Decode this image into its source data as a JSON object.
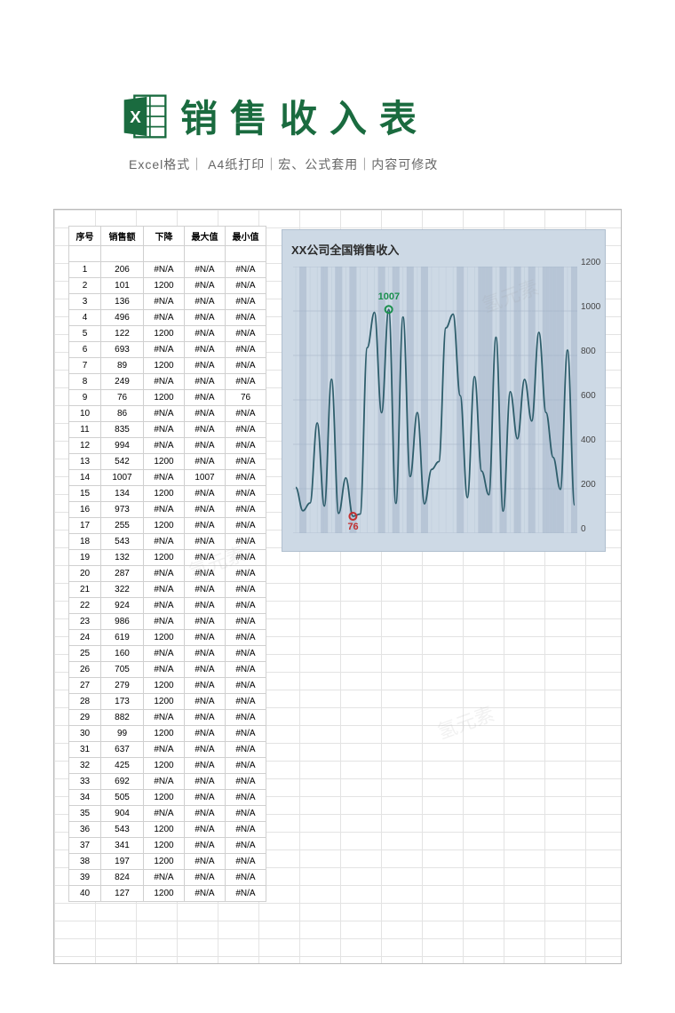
{
  "header": {
    "title": "销售收入表",
    "subtitle": "Excel格式｜ A4纸打印｜宏、公式套用｜内容可修改"
  },
  "table": {
    "columns": [
      "序号",
      "销售额",
      "下降",
      "最大值",
      "最小值"
    ],
    "rows": [
      {
        "i": 1,
        "s": 206,
        "d": "#N/A",
        "mx": "#N/A",
        "mn": "#N/A"
      },
      {
        "i": 2,
        "s": 101,
        "d": 1200,
        "mx": "#N/A",
        "mn": "#N/A"
      },
      {
        "i": 3,
        "s": 136,
        "d": "#N/A",
        "mx": "#N/A",
        "mn": "#N/A"
      },
      {
        "i": 4,
        "s": 496,
        "d": "#N/A",
        "mx": "#N/A",
        "mn": "#N/A"
      },
      {
        "i": 5,
        "s": 122,
        "d": 1200,
        "mx": "#N/A",
        "mn": "#N/A"
      },
      {
        "i": 6,
        "s": 693,
        "d": "#N/A",
        "mx": "#N/A",
        "mn": "#N/A"
      },
      {
        "i": 7,
        "s": 89,
        "d": 1200,
        "mx": "#N/A",
        "mn": "#N/A"
      },
      {
        "i": 8,
        "s": 249,
        "d": "#N/A",
        "mx": "#N/A",
        "mn": "#N/A"
      },
      {
        "i": 9,
        "s": 76,
        "d": 1200,
        "mx": "#N/A",
        "mn": 76
      },
      {
        "i": 10,
        "s": 86,
        "d": "#N/A",
        "mx": "#N/A",
        "mn": "#N/A"
      },
      {
        "i": 11,
        "s": 835,
        "d": "#N/A",
        "mx": "#N/A",
        "mn": "#N/A"
      },
      {
        "i": 12,
        "s": 994,
        "d": "#N/A",
        "mx": "#N/A",
        "mn": "#N/A"
      },
      {
        "i": 13,
        "s": 542,
        "d": 1200,
        "mx": "#N/A",
        "mn": "#N/A"
      },
      {
        "i": 14,
        "s": 1007,
        "d": "#N/A",
        "mx": 1007,
        "mn": "#N/A"
      },
      {
        "i": 15,
        "s": 134,
        "d": 1200,
        "mx": "#N/A",
        "mn": "#N/A"
      },
      {
        "i": 16,
        "s": 973,
        "d": "#N/A",
        "mx": "#N/A",
        "mn": "#N/A"
      },
      {
        "i": 17,
        "s": 255,
        "d": 1200,
        "mx": "#N/A",
        "mn": "#N/A"
      },
      {
        "i": 18,
        "s": 543,
        "d": "#N/A",
        "mx": "#N/A",
        "mn": "#N/A"
      },
      {
        "i": 19,
        "s": 132,
        "d": 1200,
        "mx": "#N/A",
        "mn": "#N/A"
      },
      {
        "i": 20,
        "s": 287,
        "d": "#N/A",
        "mx": "#N/A",
        "mn": "#N/A"
      },
      {
        "i": 21,
        "s": 322,
        "d": "#N/A",
        "mx": "#N/A",
        "mn": "#N/A"
      },
      {
        "i": 22,
        "s": 924,
        "d": "#N/A",
        "mx": "#N/A",
        "mn": "#N/A"
      },
      {
        "i": 23,
        "s": 986,
        "d": "#N/A",
        "mx": "#N/A",
        "mn": "#N/A"
      },
      {
        "i": 24,
        "s": 619,
        "d": 1200,
        "mx": "#N/A",
        "mn": "#N/A"
      },
      {
        "i": 25,
        "s": 160,
        "d": "#N/A",
        "mx": "#N/A",
        "mn": "#N/A"
      },
      {
        "i": 26,
        "s": 705,
        "d": "#N/A",
        "mx": "#N/A",
        "mn": "#N/A"
      },
      {
        "i": 27,
        "s": 279,
        "d": 1200,
        "mx": "#N/A",
        "mn": "#N/A"
      },
      {
        "i": 28,
        "s": 173,
        "d": 1200,
        "mx": "#N/A",
        "mn": "#N/A"
      },
      {
        "i": 29,
        "s": 882,
        "d": "#N/A",
        "mx": "#N/A",
        "mn": "#N/A"
      },
      {
        "i": 30,
        "s": 99,
        "d": 1200,
        "mx": "#N/A",
        "mn": "#N/A"
      },
      {
        "i": 31,
        "s": 637,
        "d": "#N/A",
        "mx": "#N/A",
        "mn": "#N/A"
      },
      {
        "i": 32,
        "s": 425,
        "d": 1200,
        "mx": "#N/A",
        "mn": "#N/A"
      },
      {
        "i": 33,
        "s": 692,
        "d": "#N/A",
        "mx": "#N/A",
        "mn": "#N/A"
      },
      {
        "i": 34,
        "s": 505,
        "d": 1200,
        "mx": "#N/A",
        "mn": "#N/A"
      },
      {
        "i": 35,
        "s": 904,
        "d": "#N/A",
        "mx": "#N/A",
        "mn": "#N/A"
      },
      {
        "i": 36,
        "s": 543,
        "d": 1200,
        "mx": "#N/A",
        "mn": "#N/A"
      },
      {
        "i": 37,
        "s": 341,
        "d": 1200,
        "mx": "#N/A",
        "mn": "#N/A"
      },
      {
        "i": 38,
        "s": 197,
        "d": 1200,
        "mx": "#N/A",
        "mn": "#N/A"
      },
      {
        "i": 39,
        "s": 824,
        "d": "#N/A",
        "mx": "#N/A",
        "mn": "#N/A"
      },
      {
        "i": 40,
        "s": 127,
        "d": 1200,
        "mx": "#N/A",
        "mn": "#N/A"
      }
    ]
  },
  "chart_data": {
    "type": "line",
    "title": "XX公司全国销售收入",
    "xlabel": "",
    "ylabel": "",
    "ylim": [
      0,
      1200
    ],
    "yticks": [
      0,
      200,
      400,
      600,
      800,
      1000,
      1200
    ],
    "x": [
      1,
      2,
      3,
      4,
      5,
      6,
      7,
      8,
      9,
      10,
      11,
      12,
      13,
      14,
      15,
      16,
      17,
      18,
      19,
      20,
      21,
      22,
      23,
      24,
      25,
      26,
      27,
      28,
      29,
      30,
      31,
      32,
      33,
      34,
      35,
      36,
      37,
      38,
      39,
      40
    ],
    "series": [
      {
        "name": "销售额",
        "values": [
          206,
          101,
          136,
          496,
          122,
          693,
          89,
          249,
          76,
          86,
          835,
          994,
          542,
          1007,
          134,
          973,
          255,
          543,
          132,
          287,
          322,
          924,
          986,
          619,
          160,
          705,
          279,
          173,
          882,
          99,
          637,
          425,
          692,
          505,
          904,
          543,
          341,
          197,
          824,
          127
        ]
      }
    ],
    "max_point": {
      "x": 14,
      "y": 1007,
      "label": "1007"
    },
    "min_point": {
      "x": 9,
      "y": 76,
      "label": "76"
    },
    "down_bars_x": [
      2,
      5,
      7,
      9,
      13,
      15,
      17,
      19,
      24,
      27,
      28,
      30,
      32,
      34,
      36,
      37,
      38,
      40
    ]
  },
  "watermark": "氢元素"
}
